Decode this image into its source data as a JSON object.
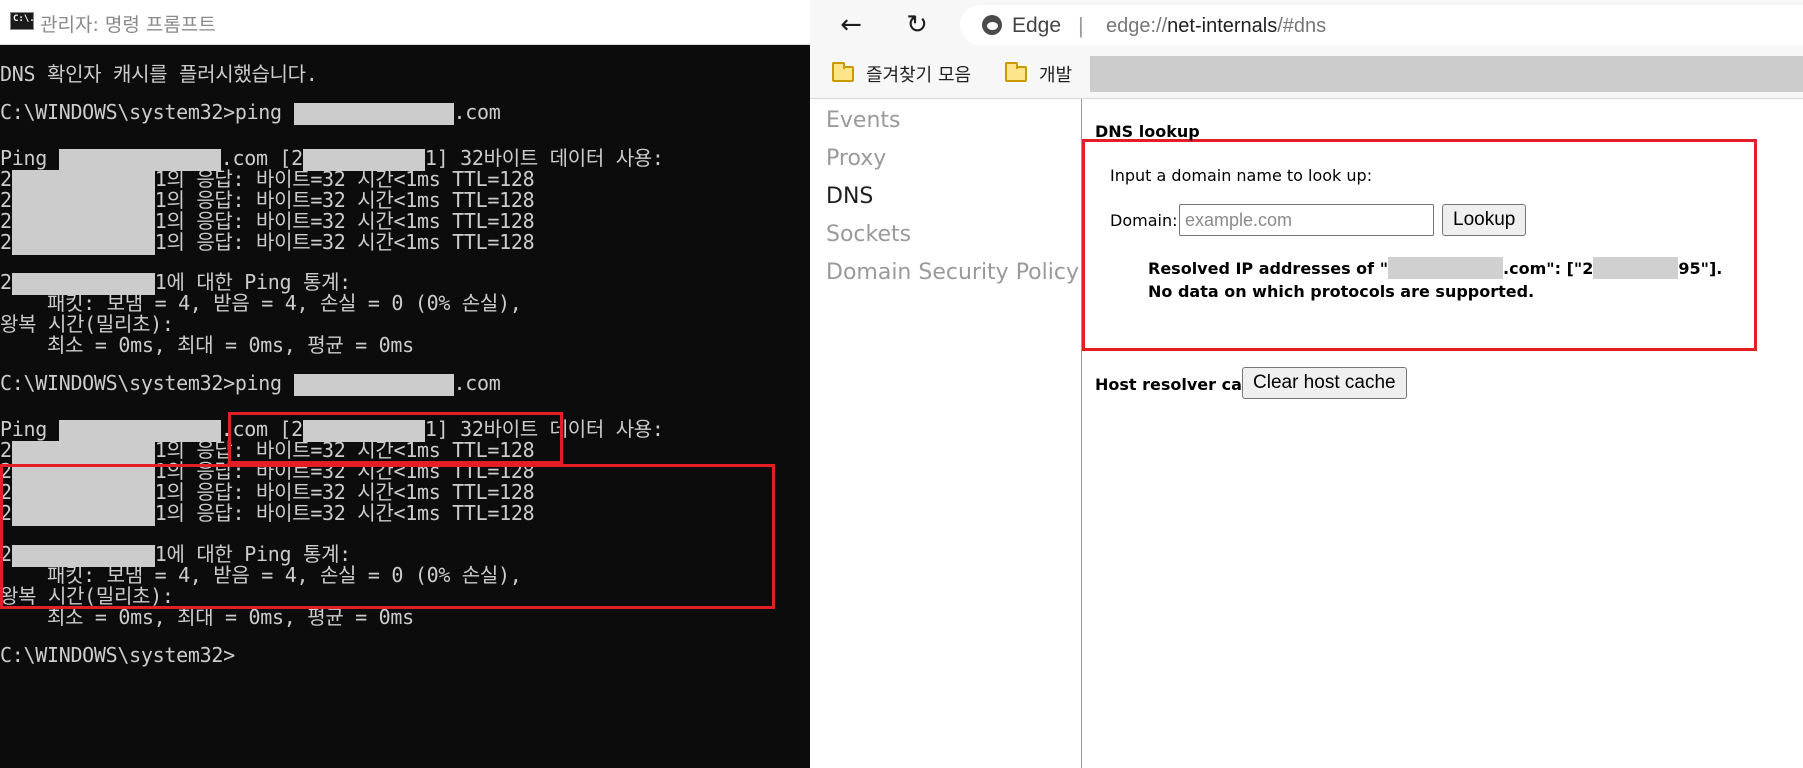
{
  "cmd": {
    "title": "관리자: 명령 프롬프트",
    "icon_name": "cmd-window-icon",
    "icon_text": "C:\\.",
    "lines": {
      "flush": "DNS 확인자 캐시를 플러시했습니다.",
      "prompt": "C:\\WINDOWS\\system32>",
      "ping_cmd": "ping ",
      "dotcom": ".com",
      "ping_head_a": "Ping ",
      "ping_head_b": ".com [2",
      "ping_head_c": "1] 32바이트 데이터 사용:",
      "reply_prefix": "2",
      "reply_text": "1의 응답: 바이트=32 시간<1ms TTL=128",
      "stats_a": "2",
      "stats_b": "1에 대한 Ping 통계:",
      "packets": "    패킷: 보냄 = 4, 받음 = 4, 손실 = 0 (0% 손실),",
      "rtt_label": "왕복 시간(밀리초):",
      "rtt_values": "    최소 = 0ms, 최대 = 0ms, 평균 = 0ms"
    }
  },
  "edge": {
    "back_icon": "back-arrow-icon",
    "refresh_icon": "refresh-icon",
    "browser_label": "Edge",
    "separator": "|",
    "url_prefix": "edge://",
    "url_host": "net-internals",
    "url_suffix": "/#dns",
    "favorites": [
      "즐겨찾기 모음",
      "개발"
    ],
    "sidebar": [
      "Events",
      "Proxy",
      "DNS",
      "Sockets",
      "Domain Security Policy"
    ],
    "active_sidebar": "DNS",
    "dns": {
      "title": "DNS lookup",
      "prompt": "Input a domain name to look up:",
      "domain_label": "Domain:",
      "domain_placeholder": "example.com",
      "lookup_button": "Lookup",
      "resolved_a": "Resolved IP addresses of \"",
      "resolved_b": ".com\": [\"2",
      "resolved_c": "95\"].",
      "no_data": "No data on which protocols are supported.",
      "cache_label": "Host resolver cache",
      "clear_button": "Clear host cache"
    },
    "highlight_color": "#e41e26"
  }
}
